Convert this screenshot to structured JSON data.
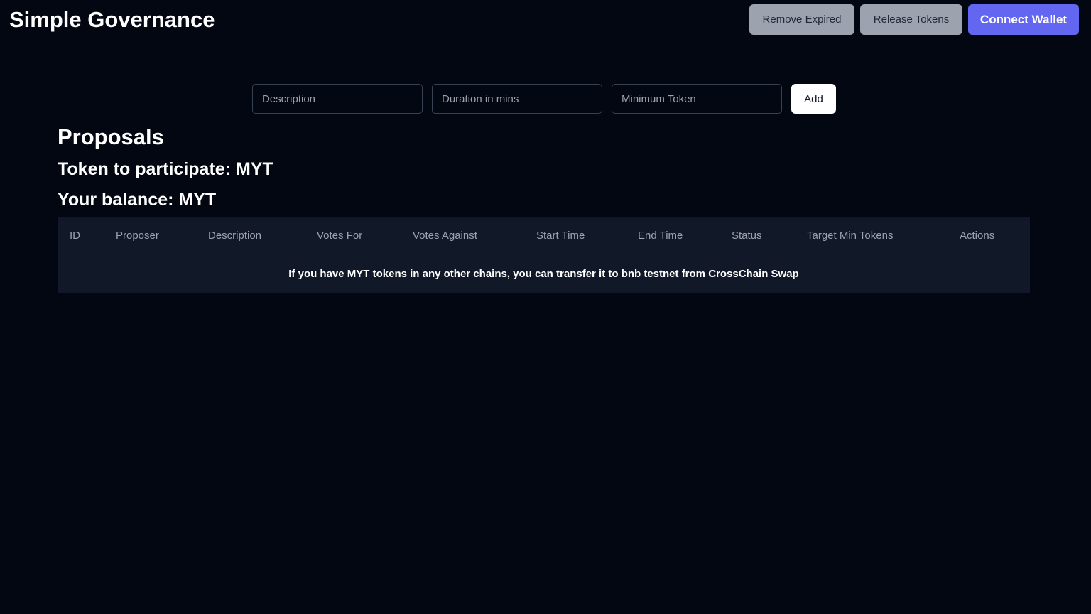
{
  "header": {
    "title": "Simple Governance",
    "remove_expired_label": "Remove Expired",
    "release_tokens_label": "Release Tokens",
    "connect_wallet_label": "Connect Wallet"
  },
  "form": {
    "description_placeholder": "Description",
    "duration_placeholder": "Duration in mins",
    "min_token_placeholder": "Minimum Token",
    "add_label": "Add"
  },
  "proposals": {
    "title": "Proposals",
    "token_line": "Token to participate: MYT",
    "balance_line": "Your balance: MYT"
  },
  "table": {
    "columns": [
      "ID",
      "Proposer",
      "Description",
      "Votes For",
      "Votes Against",
      "Start Time",
      "End Time",
      "Status",
      "Target Min Tokens",
      "Actions"
    ],
    "notice": "If you have MYT tokens in any other chains, you can transfer it to bnb testnet from CrossChain Swap"
  },
  "colors": {
    "background": "#030712",
    "table_background": "#111827",
    "accent": "#6366f1",
    "secondary_button": "#9ca3af"
  }
}
